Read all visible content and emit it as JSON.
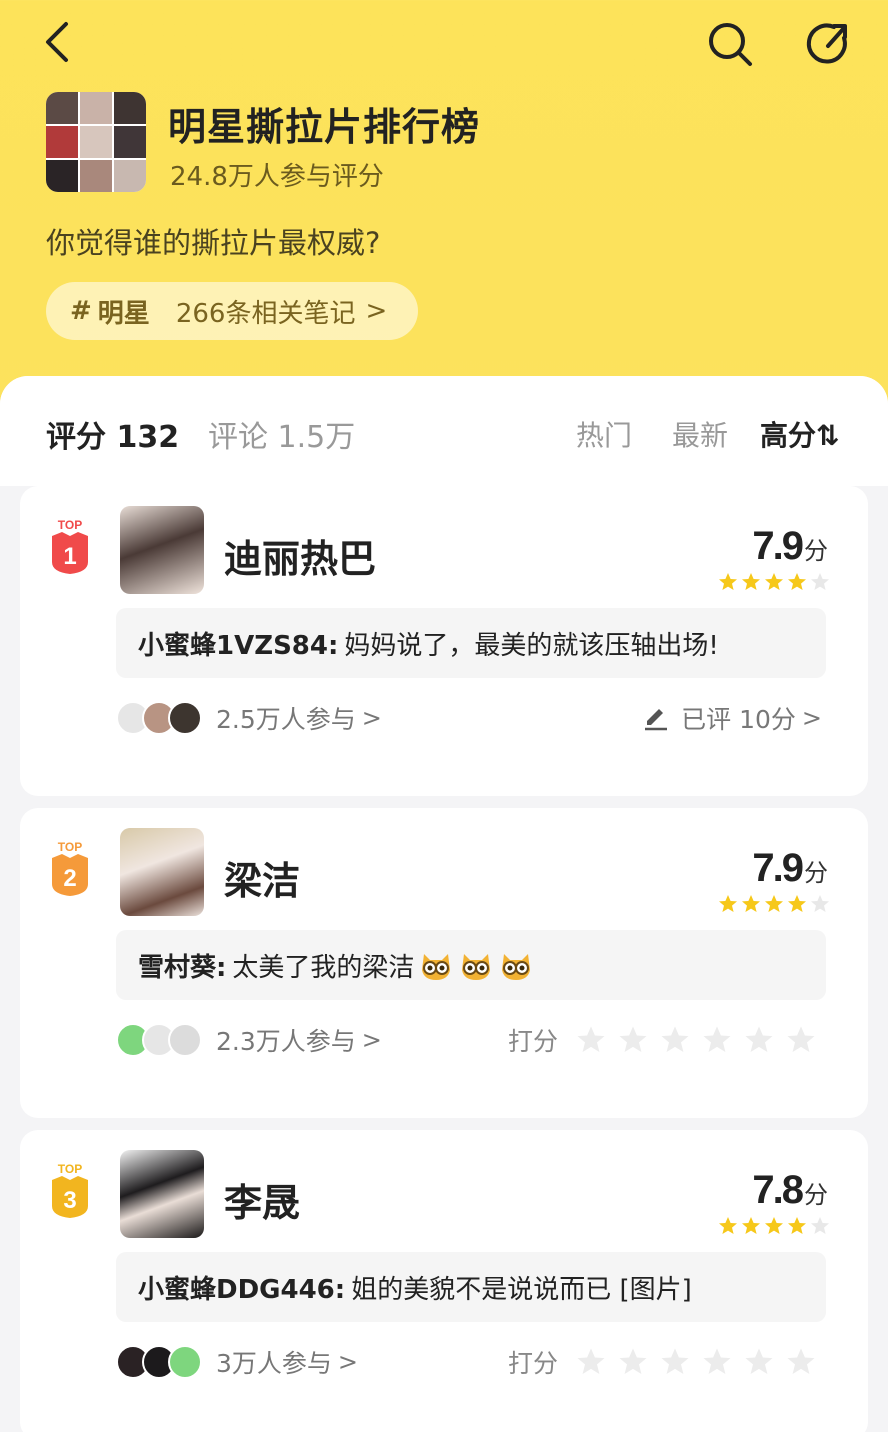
{
  "header": {
    "title": "明星撕拉片排行榜",
    "participants": "24.8万人参与评分",
    "question": "你觉得谁的撕拉片最权威?",
    "topic": {
      "hash": "#",
      "name": "明星",
      "notes": "266条相关笔记",
      "chevron": ">"
    }
  },
  "tabs": {
    "rating": "评分 132",
    "comments": "评论 1.5万"
  },
  "sort": {
    "hot": "热门",
    "new": "最新",
    "high": "高分⇅"
  },
  "ranks": [
    {
      "rank": "1",
      "top_label": "TOP",
      "name": "迪丽热巴",
      "score": "7.9",
      "unit": "分",
      "stars_filled": 4,
      "comment_author": "小蜜蜂1VZS84:",
      "comment_text": "妈妈说了，最美的就该压轴出场!",
      "participants": "2.5万人参与",
      "chevron": ">",
      "rated_text": "已评 10分",
      "badge_color": "#f04a4a"
    },
    {
      "rank": "2",
      "top_label": "TOP",
      "name": "梁洁",
      "score": "7.9",
      "unit": "分",
      "stars_filled": 4,
      "comment_author": "雪村葵:",
      "comment_text": "太美了我的梁洁",
      "participants": "2.3万人参与",
      "chevron": ">",
      "rate_label": "打分",
      "badge_color": "#f59a3a"
    },
    {
      "rank": "3",
      "top_label": "TOP",
      "name": "李晟",
      "score": "7.8",
      "unit": "分",
      "stars_filled": 4,
      "comment_author": "小蜜蜂DDG446:",
      "comment_text": "姐的美貌不是说说而已 [图片]",
      "participants": "3万人参与",
      "chevron": ">",
      "rate_label": "打分",
      "badge_color": "#f2b51f"
    }
  ],
  "colors": {
    "star_filled": "#f6c81a",
    "star_empty": "#e8e8e8",
    "brand_yellow": "#fde35a"
  },
  "icons": {
    "back": "back-icon",
    "search": "search-icon",
    "share": "share-icon",
    "edit": "pencil-icon"
  }
}
